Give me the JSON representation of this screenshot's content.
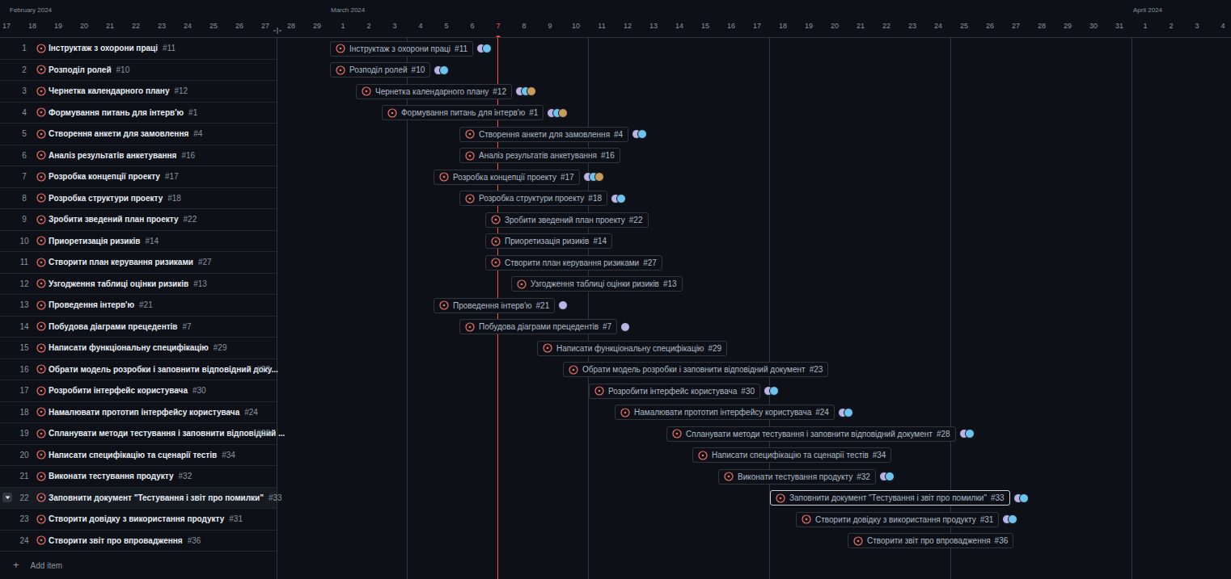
{
  "header": {
    "months": [
      {
        "label": "February 2024",
        "days": [
          "17",
          "18",
          "19",
          "20",
          "21",
          "22",
          "23",
          "24",
          "25",
          "26",
          "27",
          "28",
          "29"
        ],
        "today": ""
      },
      {
        "label": "March 2024",
        "days": [
          "1",
          "2",
          "3",
          "4",
          "5",
          "6",
          "7",
          "8",
          "9",
          "10",
          "11",
          "12",
          "13",
          "14",
          "15",
          "16",
          "17",
          "18",
          "19",
          "20",
          "21",
          "22",
          "23",
          "24",
          "25",
          "26",
          "27",
          "28",
          "29",
          "30",
          "31"
        ],
        "today": "7"
      },
      {
        "label": "April 2024",
        "days": [
          "1",
          "2",
          "3",
          "4"
        ],
        "today": ""
      }
    ]
  },
  "rows": [
    {
      "n": "1",
      "title": "Інструктаж з охорони праці",
      "num": "#11",
      "start": 1,
      "days": 1,
      "assignees": 2,
      "selected": false
    },
    {
      "n": "2",
      "title": "Розподіл ролей",
      "num": "#10",
      "start": 1,
      "days": 1,
      "assignees": 2,
      "selected": false
    },
    {
      "n": "3",
      "title": "Чернетка календарного плану",
      "num": "#12",
      "start": 2,
      "days": 1,
      "assignees": 3,
      "selected": false
    },
    {
      "n": "4",
      "title": "Формування питань для інтерв'ю",
      "num": "#1",
      "start": 3,
      "days": 3,
      "assignees": 3,
      "selected": false
    },
    {
      "n": "5",
      "title": "Створення анкети для замовлення",
      "num": "#4",
      "start": 6,
      "days": 2,
      "assignees": 2,
      "selected": false
    },
    {
      "n": "6",
      "title": "Аналіз результатів анкетування",
      "num": "#16",
      "start": 6,
      "days": 2,
      "assignees": 0,
      "selected": false
    },
    {
      "n": "7",
      "title": "Розробка концепції проекту",
      "num": "#17",
      "start": 5,
      "days": 4,
      "assignees": 3,
      "selected": false
    },
    {
      "n": "8",
      "title": "Розробка структури проекту",
      "num": "#18",
      "start": 6,
      "days": 3,
      "assignees": 2,
      "selected": false
    },
    {
      "n": "9",
      "title": "Зробити зведений план проекту",
      "num": "#22",
      "start": 7,
      "days": 2,
      "assignees": 0,
      "selected": false
    },
    {
      "n": "10",
      "title": "Приоретизація ризиків",
      "num": "#14",
      "start": 7,
      "days": 2,
      "assignees": 0,
      "selected": false
    },
    {
      "n": "11",
      "title": "Створити план керування ризиками",
      "num": "#27",
      "start": 7,
      "days": 2,
      "assignees": 0,
      "selected": false
    },
    {
      "n": "12",
      "title": "Узгодження таблиці оцінки ризиків",
      "num": "#13",
      "start": 8,
      "days": 2,
      "assignees": 0,
      "selected": false
    },
    {
      "n": "13",
      "title": "Проведення інтерв'ю",
      "num": "#21",
      "start": 5,
      "days": 1,
      "assignees": 1,
      "selected": false
    },
    {
      "n": "14",
      "title": "Побудова діаграми прецедентів",
      "num": "#7",
      "start": 6,
      "days": 1,
      "assignees": 1,
      "selected": false
    },
    {
      "n": "15",
      "title": "Написати функціональну специфікацію",
      "num": "#29",
      "start": 9,
      "days": 2,
      "assignees": 0,
      "selected": false
    },
    {
      "n": "16",
      "title": "Обрати модель розробки і заповнити відповідний документ",
      "title_cut": "Обрати модель розробки і заповнити відповідний доку...",
      "num": "#23",
      "start": 10,
      "days": 2,
      "assignees": 0,
      "selected": false
    },
    {
      "n": "17",
      "title": "Розробити інтерфейс користувача",
      "num": "#30",
      "start": 11,
      "days": 2,
      "assignees": 2,
      "selected": false
    },
    {
      "n": "18",
      "title": "Намалювати прототип інтерфейсу користувача",
      "num": "#24",
      "start": 12,
      "days": 2,
      "assignees": 2,
      "selected": false
    },
    {
      "n": "19",
      "title": "Спланувати методи тестування і заповнити відповідний документ",
      "title_cut": "Спланувати методи тестування і заповнити відповідний ...",
      "num": "#28",
      "start": 14,
      "days": 2,
      "assignees": 2,
      "selected": false
    },
    {
      "n": "20",
      "title": "Написати специфікацію та сценарії тестів",
      "num": "#34",
      "start": 15,
      "days": 2,
      "assignees": 0,
      "selected": false
    },
    {
      "n": "21",
      "title": "Виконати тестування продукту",
      "num": "#32",
      "start": 16,
      "days": 2,
      "assignees": 2,
      "selected": false
    },
    {
      "n": "22",
      "title": "Заповнити документ \"Тестування і звіт про помилки\"",
      "num": "#33",
      "start": 18,
      "days": 1,
      "assignees": 2,
      "selected": true
    },
    {
      "n": "23",
      "title": "Створити довідку з використання продукту",
      "num": "#31",
      "start": 19,
      "days": 2,
      "assignees": 2,
      "selected": false
    },
    {
      "n": "24",
      "title": "Створити звіт про впровадження",
      "num": "#36",
      "start": 21,
      "days": 1,
      "assignees": 0,
      "selected": false
    }
  ],
  "add_item": {
    "icon": "+",
    "label": "Add item"
  }
}
